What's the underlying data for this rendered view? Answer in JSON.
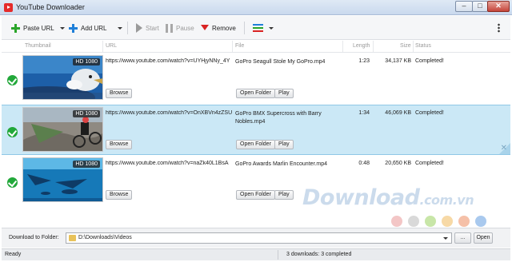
{
  "window": {
    "title": "YouTube Downloader",
    "minimize_glyph": "–",
    "maximize_glyph": "□",
    "close_glyph": "✕"
  },
  "toolbar": {
    "paste_url": "Paste URL",
    "add_url": "Add URL",
    "start": "Start",
    "pause": "Pause",
    "remove": "Remove"
  },
  "columns": {
    "thumbnail": "Thumbnail",
    "url": "URL",
    "file": "File",
    "length": "Length",
    "size": "Size",
    "status": "Status"
  },
  "row_buttons": {
    "browse": "Browse",
    "open_folder": "Open Folder",
    "play": "Play"
  },
  "downloads": [
    {
      "quality": "HD 1080",
      "url": "https://www.youtube.com/watch?v=UYHjyNNy_4Y",
      "file": "GoPro  Seagull Stole My GoPro.mp4",
      "length": "1:23",
      "size": "34,137 KB",
      "status": "Completed!",
      "selected": false
    },
    {
      "quality": "HD 1080",
      "url": "https://www.youtube.com/watch?v=OnXBVn4zZSU",
      "file": "GoPro  BMX Supercross with Barry Nobles.mp4",
      "length": "1:34",
      "size": "46,069 KB",
      "status": "Completed!",
      "selected": true
    },
    {
      "quality": "HD 1080",
      "url": "https://www.youtube.com/watch?v=naZk40L1BsA",
      "file": "GoPro Awards  Marlin Encounter.mp4",
      "length": "0:48",
      "size": "20,650 KB",
      "status": "Completed!",
      "selected": false
    }
  ],
  "bottom": {
    "download_to_label": "Download to Folder:",
    "folder_path": "D:\\Downloads\\Videos",
    "browse_button": "...",
    "open_button": "Open"
  },
  "statusbar": {
    "state": "Ready",
    "summary": "3 downloads: 3 completed"
  },
  "watermark": {
    "brand": "Download",
    "suffix": ".com.vn",
    "dot_colors": [
      "#f3c6c6",
      "#d9d9d9",
      "#c8e6a8",
      "#f7d9a6",
      "#f5c0a8",
      "#a9c9ee"
    ]
  },
  "colors": {
    "accent_green": "#2aa52a",
    "accent_blue": "#1f7fd8",
    "remove_red": "#d92323",
    "selected_row": "#cbe8f6",
    "check_green": "#22a83a"
  },
  "icons": {
    "paste_url": "plus-green-icon",
    "add_url": "plus-blue-icon",
    "start": "play-icon",
    "pause": "pause-icon",
    "remove": "remove-triangle-icon",
    "format": "format-lines-icon",
    "menu": "more-vertical-icon",
    "status_done": "check-circle-icon",
    "folder": "folder-icon"
  }
}
